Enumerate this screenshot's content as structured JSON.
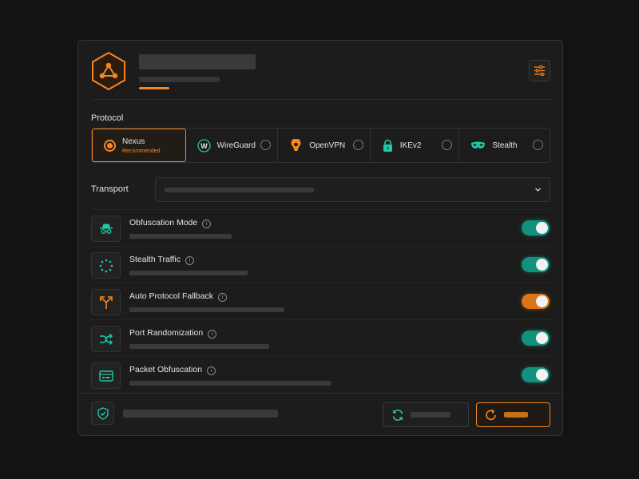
{
  "protocol_label": "Protocol",
  "transport_label": "Transport",
  "protocols": [
    {
      "name": "Nexus",
      "sub": "Recommended",
      "icon": "nexus-radio-icon",
      "selected": true
    },
    {
      "name": "WireGuard",
      "icon": "wireguard-icon",
      "selected": false
    },
    {
      "name": "OpenVPN",
      "icon": "openvpn-icon",
      "selected": false
    },
    {
      "name": "IKEv2",
      "icon": "lock-icon",
      "selected": false
    },
    {
      "name": "Stealth",
      "icon": "mask-icon",
      "selected": false
    }
  ],
  "features": [
    {
      "title": "Obfuscation Mode",
      "icon": "incognito-icon",
      "enabled": true,
      "color": "teal"
    },
    {
      "title": "Stealth Traffic",
      "icon": "dots-circle-icon",
      "enabled": true,
      "color": "teal"
    },
    {
      "title": "Auto Protocol Fallback",
      "icon": "fork-arrows-icon",
      "enabled": true,
      "color": "orange"
    },
    {
      "title": "Port Randomization",
      "icon": "shuffle-icon",
      "enabled": true,
      "color": "teal"
    },
    {
      "title": "Packet Obfuscation",
      "icon": "packet-icon",
      "enabled": true,
      "color": "teal"
    }
  ],
  "colors": {
    "accent": "#f5871f",
    "teal": "#1fc9a7",
    "background": "#131313",
    "panel": "#1c1c1c"
  }
}
